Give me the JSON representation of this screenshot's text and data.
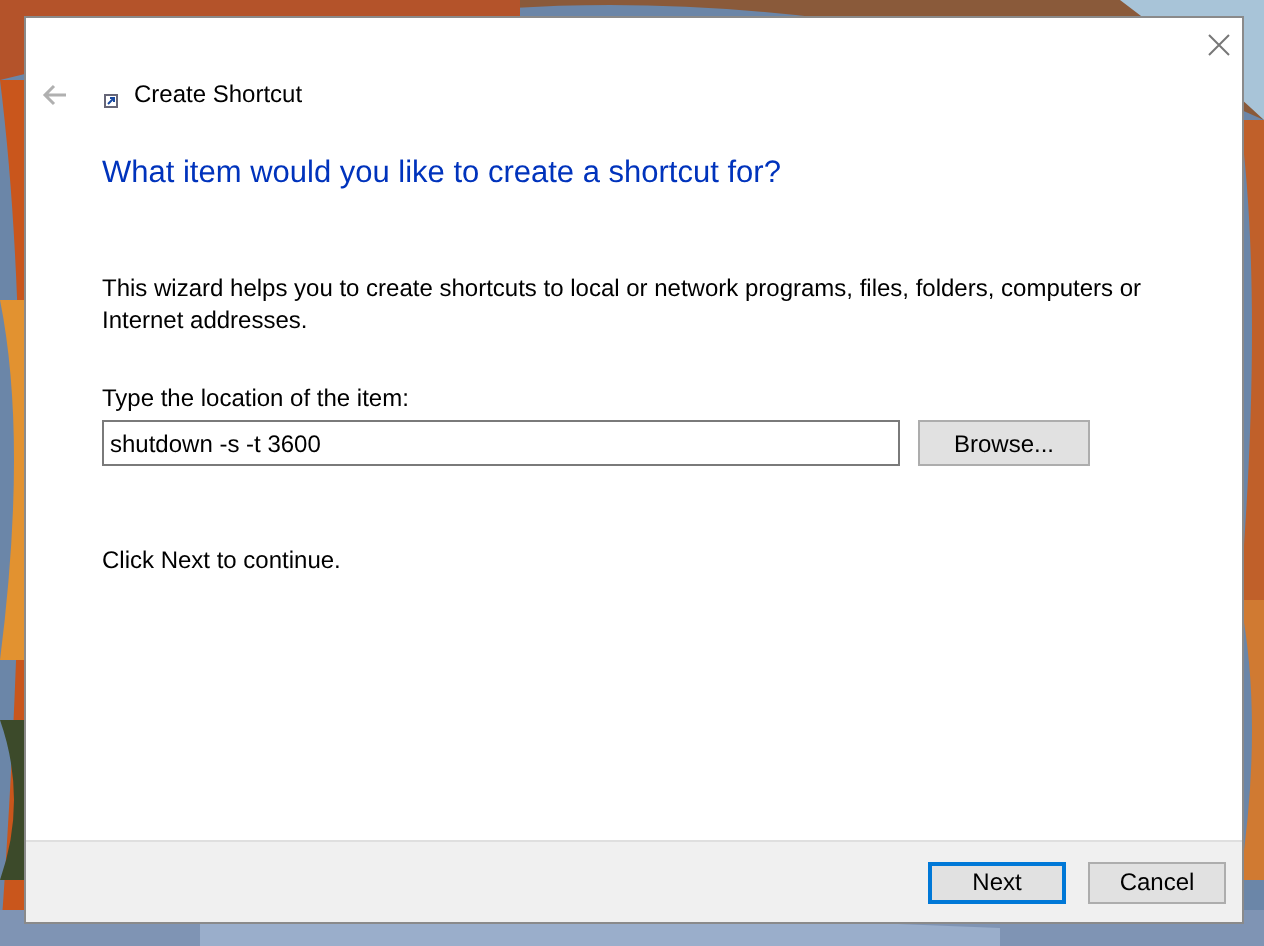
{
  "window": {
    "title": "Create Shortcut"
  },
  "heading": "What item would you like to create a shortcut for?",
  "description": "This wizard helps you to create shortcuts to local or network programs, files, folders, computers or Internet addresses.",
  "location": {
    "label": "Type the location of the item:",
    "value": "shutdown -s -t 3600",
    "browse_button": "Browse..."
  },
  "hint": "Click Next to continue.",
  "buttons": [
    {
      "label": "Next",
      "default": true
    },
    {
      "label": "Cancel",
      "default": false
    }
  ]
}
